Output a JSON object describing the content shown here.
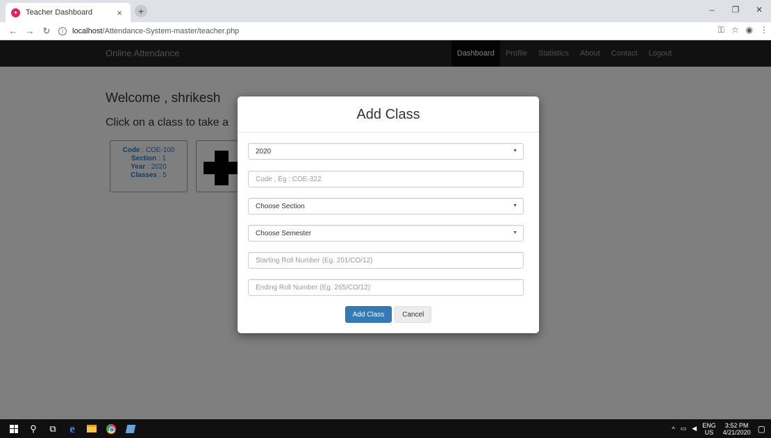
{
  "browser": {
    "tab_title": "Teacher Dashboard",
    "tab_close": "×",
    "new_tab": "+",
    "url_host": "localhost",
    "url_path": "/Attendance-System-master/teacher.php",
    "win_minimize": "–",
    "win_maximize": "❐",
    "win_close": "✕"
  },
  "navbar": {
    "brand": "Online Attendance",
    "links": [
      "Dashboard",
      "Profile",
      "Statistics",
      "About",
      "Contact",
      "Logout"
    ],
    "active": "Dashboard"
  },
  "dashboard": {
    "welcome": "Welcome , shrikesh",
    "subtitle": "Click on a class to take a",
    "class_card": {
      "code_label": "Code",
      "code_value": ": COE-100",
      "section_label": "Section",
      "section_value": ": 1",
      "year_label": "Year",
      "year_value": ": 2020",
      "classes_label": "Classes",
      "classes_value": ": 5"
    }
  },
  "modal": {
    "title": "Add Class",
    "year_select": "2020",
    "code_placeholder": "Code , Eg : COE-322",
    "section_select": "Choose Section",
    "semester_select": "Choose Semester",
    "start_roll_placeholder": "Starting Roll Number (Eg. 201/CO/12)",
    "end_roll_placeholder": "Ending Roll Number (Eg. 265/CO/12)",
    "add_button": "Add Class",
    "cancel_button": "Cancel"
  },
  "taskbar": {
    "lang_top": "ENG",
    "lang_bottom": "US",
    "time": "3:52 PM",
    "date": "4/21/2020"
  },
  "colors": {
    "primary": "#337ab7",
    "navbar": "#222222"
  }
}
